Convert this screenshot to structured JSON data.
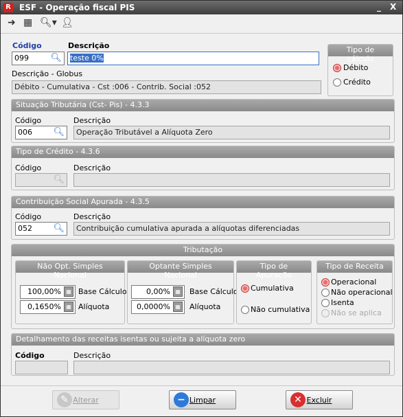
{
  "window": {
    "title": "ESF - Operação fiscal PIS",
    "app_icon": "R",
    "min_glyph": "_",
    "close_glyph": "X"
  },
  "toolbar": {
    "icons": [
      "exit-icon",
      "card-icon",
      "search-icon",
      "user-icon"
    ]
  },
  "header": {
    "codigo_label": "Código",
    "codigo_value": "099",
    "descricao_label": "Descrição",
    "descricao_value": "teste 0%",
    "globus_label": "Descrição - Globus",
    "globus_value": "Débito - Cumulativa - Cst :006 - Contrib. Social :052"
  },
  "tipo_calculo": {
    "title": "Tipo de cálculo",
    "debito": "Débito",
    "credito": "Crédito",
    "selected": "Débito"
  },
  "situacao": {
    "title": "Situação Tributária (Cst- Pis) - 4.3.3",
    "codigo_label": "Código",
    "codigo": "006",
    "descricao_label": "Descrição",
    "descricao": "Operação Tributável a Alíquota Zero"
  },
  "tipo_credito": {
    "title": "Tipo de Crédito - 4.3.6",
    "codigo_label": "Código",
    "codigo": "",
    "descricao_label": "Descrição",
    "descricao": ""
  },
  "contribuicao": {
    "title": "Contribuição Social Apurada - 4.3.5",
    "codigo_label": "Código",
    "codigo": "052",
    "descricao_label": "Descrição",
    "descricao": "Contribuição cumulativa apurada a alíquotas diferenciadas"
  },
  "tributacao": {
    "title": "Tributação",
    "nao_opt": {
      "title": "Não Opt. Simples Nacional",
      "base_value": "100,00%",
      "base_label": "Base Cálculo",
      "aliq_value": "0,1650%",
      "aliq_label": "Alíquota"
    },
    "opt": {
      "title": "Optante Simples Nacional",
      "base_value": "0,00%",
      "base_label": "Base Cálculo",
      "aliq_value": "0,0000%",
      "aliq_label": "Alíquota"
    },
    "apuracao": {
      "title": "Tipo de Apuração",
      "cumulativa": "Cumulativa",
      "nao_cumulativa": "Não cumulativa",
      "selected": "Cumulativa"
    },
    "receita": {
      "title": "Tipo de Receita",
      "operacional": "Operacional",
      "nao_operacional": "Não operacional",
      "isenta": "Isenta",
      "nao_se_aplica": "Não se aplica",
      "selected": "Operacional"
    }
  },
  "detalhamento": {
    "title": "Detalhamento das receitas isentas ou sujeita a alíquota zero",
    "codigo_label": "Código",
    "descricao_label": "Descrição",
    "codigo": "",
    "descricao": ""
  },
  "buttons": {
    "alterar": "Alterar",
    "limpar": "Limpar",
    "excluir": "Excluir"
  },
  "colors": {
    "accent_blue": "#1f3fa8",
    "header_gray": "#8f8f8f",
    "selected_radio": "#c02828"
  }
}
